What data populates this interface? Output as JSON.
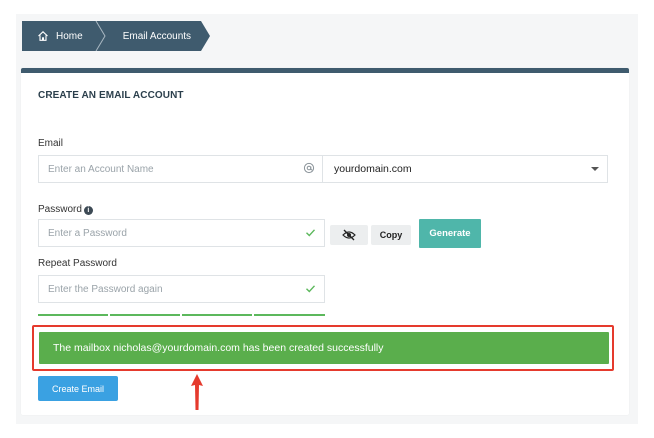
{
  "breadcrumb": {
    "home_label": "Home",
    "current_label": "Email Accounts"
  },
  "form": {
    "title": "CREATE AN EMAIL ACCOUNT",
    "email_label": "Email",
    "email_placeholder": "Enter an Account Name",
    "domain_value": "yourdomain.com",
    "password_label": "Password",
    "password_placeholder": "Enter a Password",
    "copy_label": "Copy",
    "generate_label": "Generate",
    "repeat_label": "Repeat Password",
    "repeat_placeholder": "Enter the Password again",
    "strength_segments_filled": 4,
    "create_label": "Create Email"
  },
  "alert": {
    "message": "The mailbox nicholas@yourdomain.com has been created successfully"
  },
  "colors": {
    "header_dark": "#3f5b6e",
    "success_green": "#5aae4c",
    "generate_teal": "#4fb6aa",
    "create_blue": "#3aa1e2",
    "highlight_red": "#e53a2d"
  }
}
